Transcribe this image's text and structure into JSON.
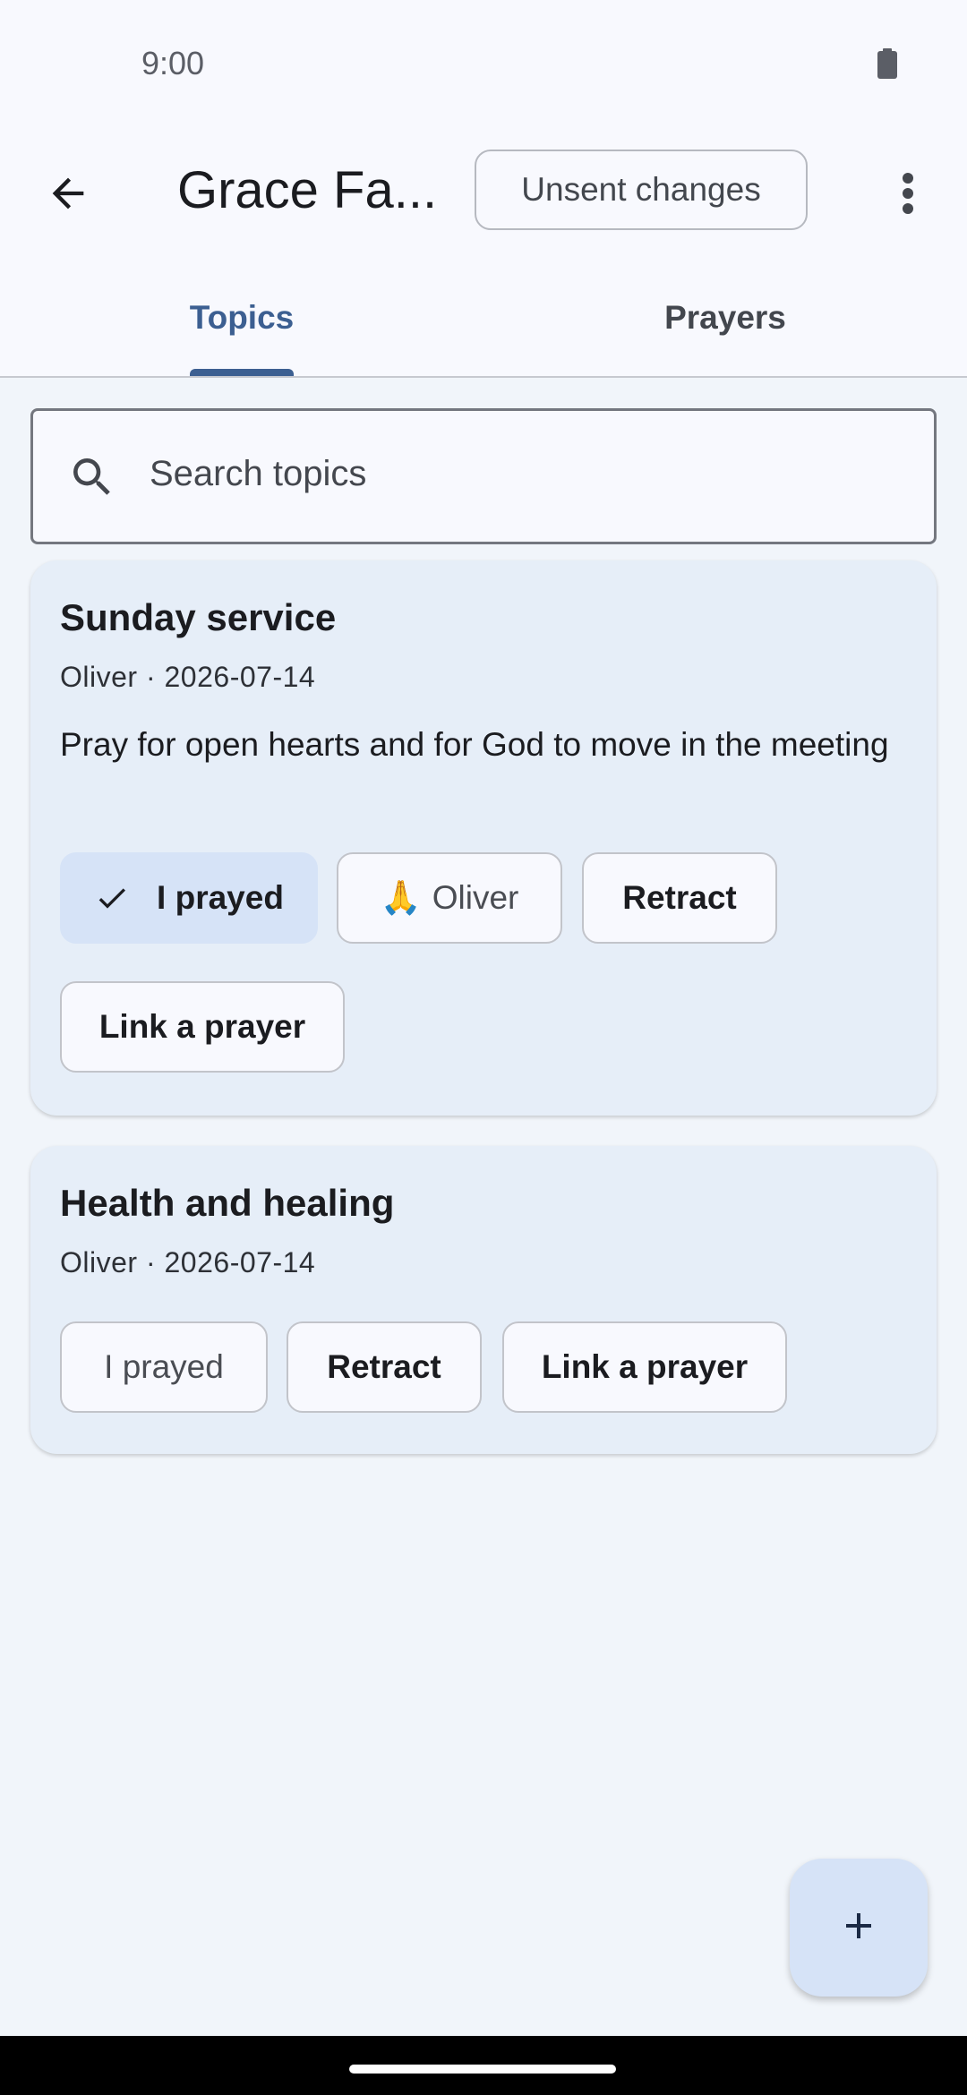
{
  "status_bar": {
    "time": "9:00",
    "battery_icon": "battery-full-icon"
  },
  "app_bar": {
    "back_icon": "arrow-back-icon",
    "title": "Grace Fa...",
    "unsent_changes_label": "Unsent changes",
    "more_icon": "more-vert-icon"
  },
  "tabs": [
    {
      "label": "Topics",
      "selected": true
    },
    {
      "label": "Prayers",
      "selected": false
    }
  ],
  "search": {
    "icon": "search-icon",
    "placeholder": "Search topics"
  },
  "topics": [
    {
      "title": "Sunday service",
      "meta": "Oliver · 2026-07-14",
      "body": "Pray for open hearts and for God to move in the meeting",
      "i_prayed_label": "I prayed",
      "i_prayed_selected": true,
      "prayed_by_emoji": "🙏",
      "prayed_by_name": "Oliver",
      "retract_label": "Retract",
      "link_label": "Link a prayer"
    },
    {
      "title": "Health and healing",
      "meta": "Oliver · 2026-07-14",
      "i_prayed_label": "I prayed",
      "i_prayed_selected": false,
      "retract_label": "Retract",
      "link_label": "Link a prayer"
    }
  ],
  "fab": {
    "icon": "add-icon"
  },
  "colors": {
    "accent": "#3c5f91",
    "card_bg": "#e6eef8",
    "selected_chip_bg": "#d6e3f7",
    "page_bg": "#f1f5fa"
  }
}
